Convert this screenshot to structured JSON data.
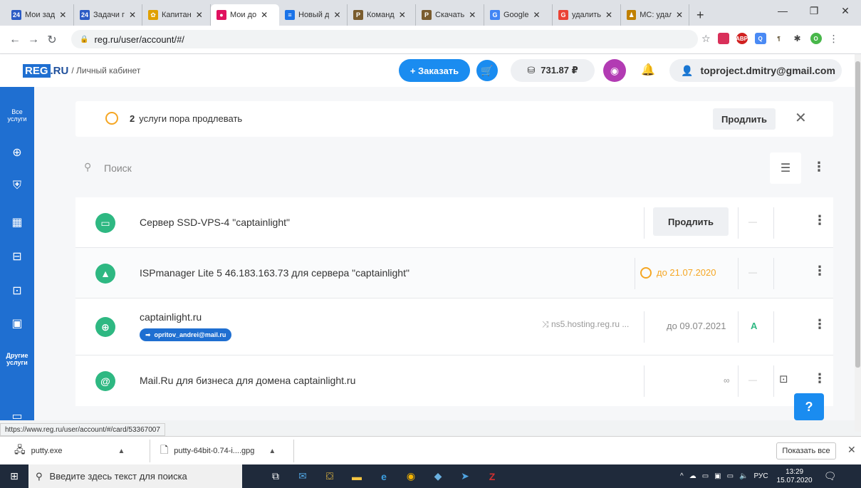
{
  "browser": {
    "tabs": [
      {
        "fav": "24",
        "favcolor": "#2c5cc5",
        "label": "Мои зад"
      },
      {
        "fav": "24",
        "favcolor": "#2c5cc5",
        "label": "Задачи г"
      },
      {
        "fav": "✿",
        "favcolor": "#e0a000",
        "label": "Капитан"
      },
      {
        "fav": "●",
        "favcolor": "#e0115f",
        "label": "Мои до"
      },
      {
        "fav": "≡",
        "favcolor": "#1a73e8",
        "label": "Новый д"
      },
      {
        "fav": "P",
        "favcolor": "#7a5c2e",
        "label": "Команд"
      },
      {
        "fav": "P",
        "favcolor": "#7a5c2e",
        "label": "Скачать"
      },
      {
        "fav": "G",
        "favcolor": "#4285f4",
        "label": "Google"
      },
      {
        "fav": "G",
        "favcolor": "#ea4335",
        "label": "удалить"
      },
      {
        "fav": "♟",
        "favcolor": "#c08000",
        "label": "MC: удал"
      }
    ],
    "active_tab": 3,
    "url": "reg.ru/user/account/#/"
  },
  "header": {
    "logo_reg": "REG",
    "logo_ru": ".RU",
    "logo_sub": "/ Личный кабинет",
    "order_label": "+ Заказать",
    "balance": "731.87 ₽",
    "account_email": "toproject.dmitry@gmail.com"
  },
  "sidebar": {
    "all_services": "Все услуги",
    "other_services": "Другие услуги"
  },
  "notice": {
    "count": "2",
    "text": "услуги пора продлевать",
    "renew_label": "Продлить"
  },
  "search": {
    "placeholder": "Поиск"
  },
  "services": [
    {
      "title": "Сервер SSD-VPS-4 \"captainlight\"",
      "action": "Продлить"
    },
    {
      "title": "ISPmanager Lite 5 46.183.163.73 для сервера \"captainlight\"",
      "date": "до 21.07.2020"
    },
    {
      "title": "captainlight.ru",
      "badge": "opritov_andrei@mail.ru",
      "ns": "ns5.hosting.reg.ru ...",
      "date": "до 09.07.2021",
      "status": "A"
    },
    {
      "title": "Mail.Ru для бизнеса для домена captainlight.ru",
      "period": "∞"
    }
  ],
  "help_label": "?",
  "status_url": "https://www.reg.ru/user/account/#/card/53367007",
  "downloads": [
    {
      "name": "putty.exe"
    },
    {
      "name": "putty-64bit-0.74-i....gpg"
    }
  ],
  "show_all": "Показать все",
  "taskbar": {
    "search_placeholder": "Введите здесь текст для поиска",
    "lang": "РУС",
    "time": "13:29",
    "date": "15.07.2020"
  }
}
